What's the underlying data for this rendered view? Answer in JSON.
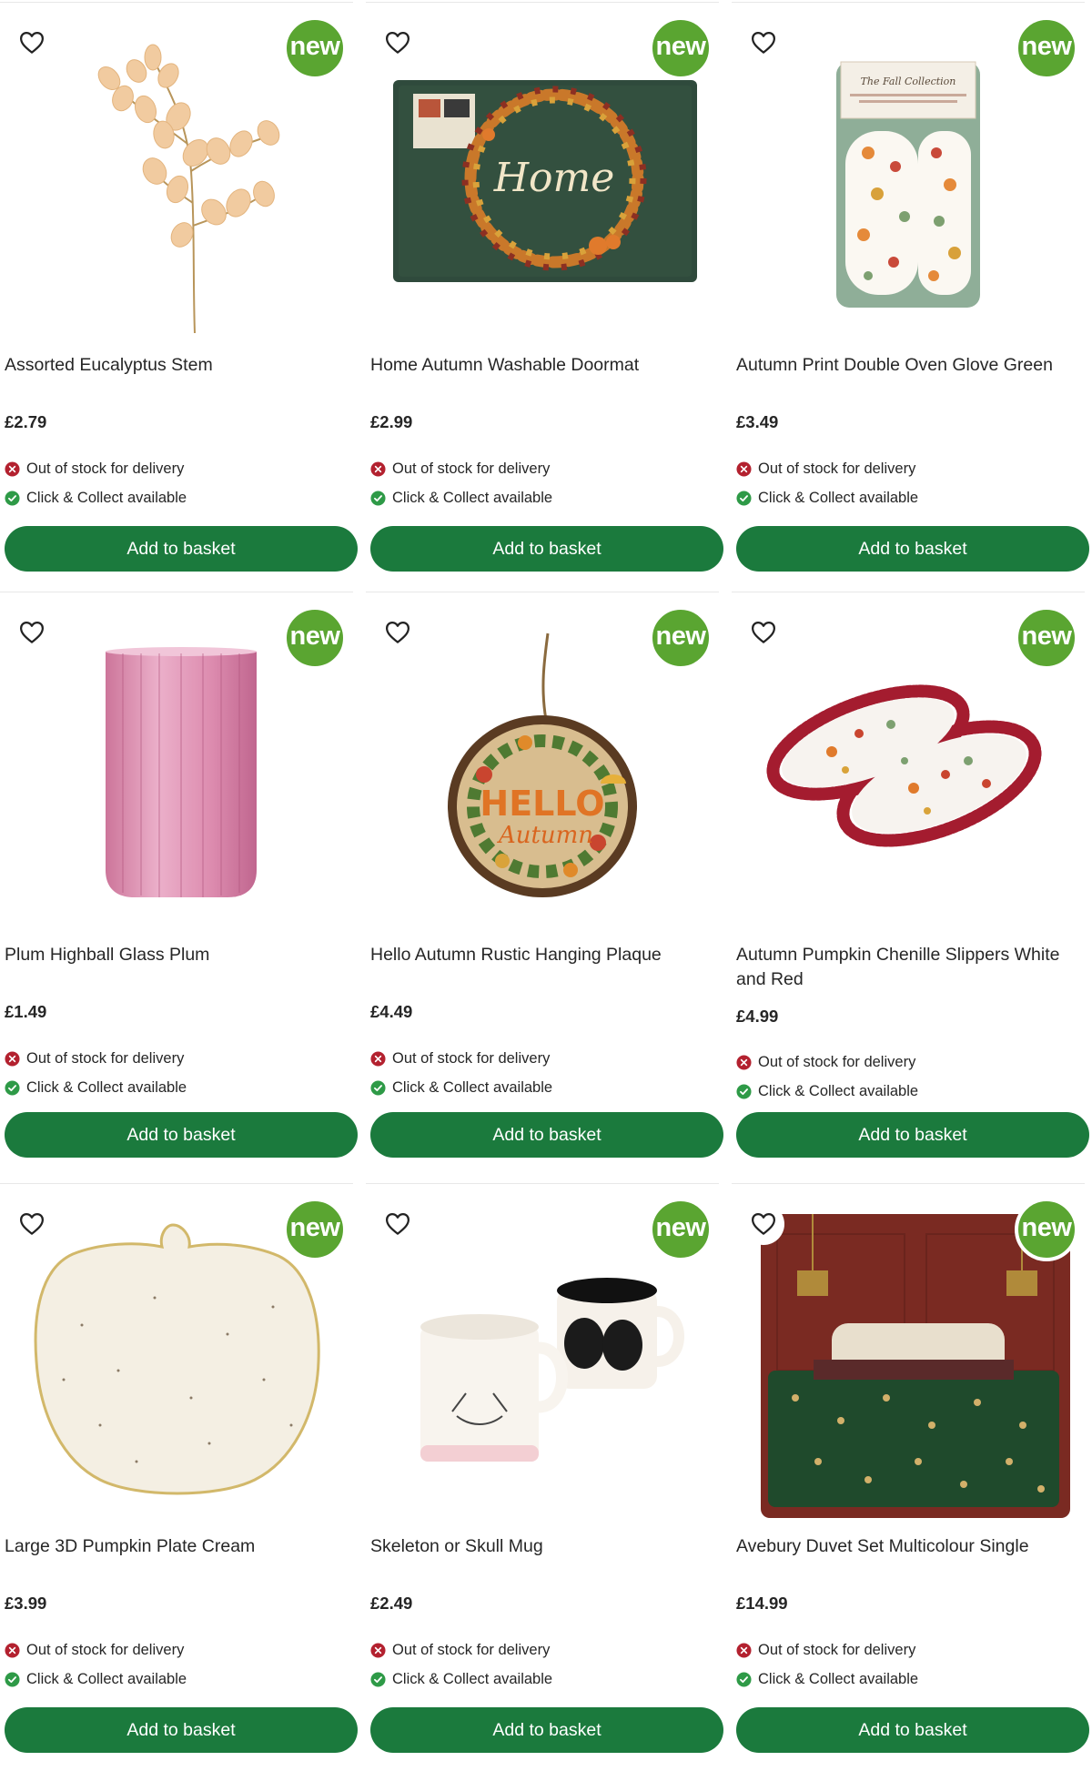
{
  "badge_label": "new",
  "add_label": "Add to basket",
  "stock_label": "Out of stock for delivery",
  "collect_label": "Click & Collect available",
  "colors": {
    "button": "#1b7a3d",
    "badge": "#5aa531",
    "out_of_stock": "#b3212f",
    "available": "#2e9a47"
  },
  "products": [
    {
      "title": "Assorted Eucalyptus Stem",
      "price": "£2.79",
      "image_icon": "eucalyptus-stem-image"
    },
    {
      "title": "Home Autumn Washable Doormat",
      "price": "£2.99",
      "image_icon": "doormat-image",
      "mat_text": "Home"
    },
    {
      "title": "Autumn Print Double Oven Glove Green",
      "price": "£3.49",
      "image_icon": "oven-glove-image",
      "pack_text": "The Fall Collection"
    },
    {
      "title": "Plum Highball Glass Plum",
      "price": "£1.49",
      "image_icon": "highball-glass-image"
    },
    {
      "title": "Hello Autumn Rustic Hanging Plaque",
      "price": "£4.49",
      "image_icon": "hanging-plaque-image",
      "plaque_line1": "HELLO",
      "plaque_line2": "Autumn"
    },
    {
      "title": "Autumn Pumpkin Chenille Slippers White and Red",
      "price": "£4.99",
      "image_icon": "slippers-image"
    },
    {
      "title": "Large 3D Pumpkin Plate Cream",
      "price": "£3.99",
      "image_icon": "pumpkin-plate-image"
    },
    {
      "title": "Skeleton or Skull Mug",
      "price": "£2.49",
      "image_icon": "mugs-image"
    },
    {
      "title": "Avebury Duvet Set Multicolour Single",
      "price": "£14.99",
      "image_icon": "duvet-set-image"
    }
  ]
}
